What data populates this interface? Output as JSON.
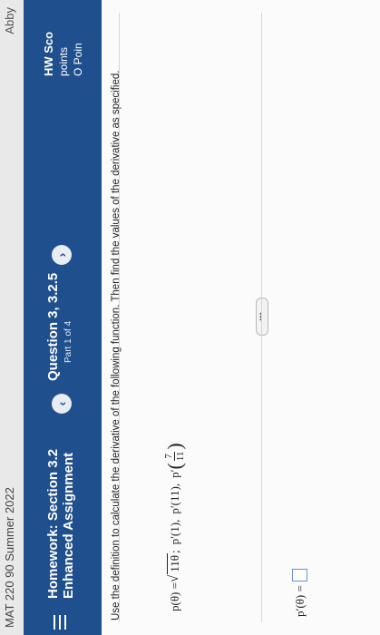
{
  "topbar": {
    "course": "MAT 220 90 Summer 2022",
    "user": "Abby"
  },
  "header": {
    "title_line1": "Homework: Section 3.2",
    "title_line2": "Enhanced Assignment",
    "question": "Question 3, 3.2.5",
    "part": "Part 1 of 4",
    "score_label": "HW Sco",
    "points_label": "points",
    "points_value": "O Poin"
  },
  "problem": {
    "instructions": "Use the definition to calculate the derivative of the following function. Then find the values of the derivative as specified.",
    "func_lhs": "p(θ) =",
    "func_radicand": "11θ",
    "sep1": ";",
    "eval1": "p′(1),",
    "eval2": "p′(11),",
    "eval3_prefix": "p′",
    "frac_num": "7",
    "frac_den": "11",
    "expand_label": "•••",
    "answer_lhs": "p′(θ) ="
  },
  "icons": {
    "menu": "hamburger-icon",
    "prev": "chevron-left-icon",
    "next": "chevron-right-icon"
  },
  "colors": {
    "header_bg": "#1f4f8c",
    "answer_box_border": "#6a8fd0"
  }
}
